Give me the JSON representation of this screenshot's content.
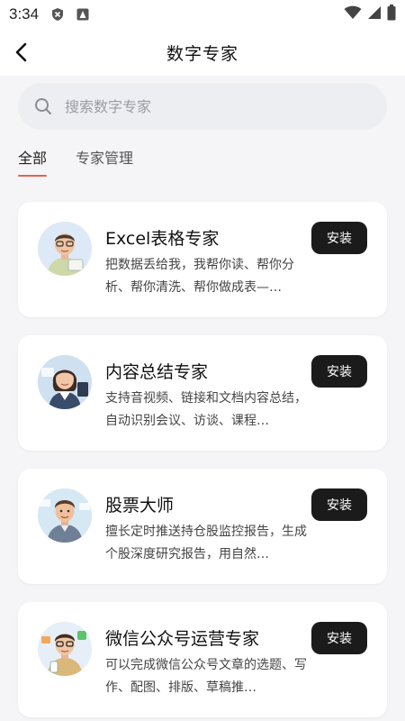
{
  "status_bar": {
    "time": "3:34"
  },
  "header": {
    "title": "数字专家"
  },
  "search": {
    "placeholder": "搜索数字专家"
  },
  "tabs": [
    {
      "label": "全部",
      "active": true
    },
    {
      "label": "专家管理",
      "active": false
    }
  ],
  "experts": [
    {
      "name": "Excel表格专家",
      "desc": "把数据丢给我，我帮你读、帮你分析、帮你清洗、帮你做成表—…",
      "action": "安装"
    },
    {
      "name": "内容总结专家",
      "desc": "支持音视频、链接和文档内容总结，自动识别会议、访谈、课程…",
      "action": "安装"
    },
    {
      "name": "股票大师",
      "desc": "擅长定时推送持仓股监控报告，生成个股深度研究报告，用自然…",
      "action": "安装"
    },
    {
      "name": "微信公众号运营专家",
      "desc": "可以完成微信公众号文章的选题、写作、配图、排版、草稿推…",
      "action": "安装"
    }
  ],
  "colors": {
    "accent": "#e8604c",
    "button_bg": "#1b1b1b"
  }
}
